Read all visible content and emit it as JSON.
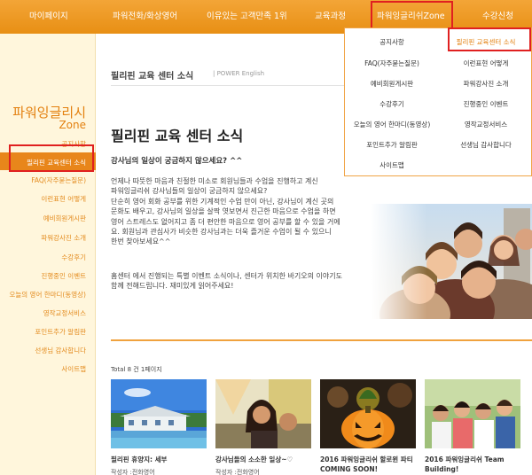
{
  "nav": {
    "items": [
      "마이페이지",
      "파워전화/화상영어",
      "이유있는 고객만족 1위",
      "교육과정",
      "파워잉글리쉬Zone",
      "수강신청"
    ]
  },
  "dropdown": {
    "col1": [
      "공지사항",
      "FAQ(자주묻는질문)",
      "예비회원게시판",
      "수강후기",
      "오늘의 영어 한마디(동영상)",
      "포인트추가 알림판",
      "사이트맵"
    ],
    "col2": [
      "필리핀 교육센터 소식",
      "이런표현 어떻게",
      "파워강사진 소개",
      "진행중인 이벤트",
      "영작교정서비스",
      "선생님 감사합니다"
    ]
  },
  "sidebar": {
    "title": "파워잉글리시",
    "subtitle": "Zone",
    "items": [
      "공지사항",
      "필리핀 교육센터 소식",
      "FAQ(자주묻는질문)",
      "이런표현 어떻게",
      "예비회원게시판",
      "파워강사진 소개",
      "수강후기",
      "진행중인 이벤트",
      "오늘의 영어 한마디(동영상)",
      "영작교정서비스",
      "포인트추가 알림판",
      "선생님 감사합니다",
      "사이트맵"
    ]
  },
  "main": {
    "breadcrumb_title": "필리핀 교육 센터 소식",
    "breadcrumb_sub": "| POWER English",
    "title": "필리핀 교육 센터 소식",
    "subtitle": "강사님의 일상이 궁금하지 않으세요? ^^",
    "para1_lines": [
      "언제나 따뜻한 마음과 친절한 미소로 회원님들과 수업을 진행하고 계신",
      "파워잉글리쉬 강사님들의 일상이 궁금하지 않으세요?",
      "단순히 영어 회화 공부를 위한 기계적인 수업 만이 아닌, 강사님이 계신 곳의",
      "문화도 배우고, 강사님의 일상을 살짝 엿보면서 진근한 마음으로 수업을 하면",
      "영어 스트레스도 없어지고 좀 더 편안한 마음으로 영어 공부를 할 수 있을 거에",
      "요. 회원님과 관심사가 비슷한 강사님과는 더욱 즐거운 수업이 될 수 있으니",
      "한번 찾아보세요^^"
    ],
    "para2_lines": [
      "홈센터 에서 진행되는 특별 이벤트 소식이나, 센터가 위치한 바기오의 이야기도",
      "함께 전해드립니다. 재미있게 읽어주세요!"
    ],
    "total": "Total 8 건 1페이지"
  },
  "cards": [
    {
      "title": "필리핀 휴양지: 세부",
      "author": "작성자 :전화영어"
    },
    {
      "title": "강사님들의 소소한 일상~♡",
      "author": "작성자 :전화영어"
    },
    {
      "title": "2016 파워잉글리쉬 할로윈 파티 COMING SOON!",
      "author": ""
    },
    {
      "title": "2016 파워잉글리쉬 Team Building!",
      "author": ""
    }
  ],
  "colors": {
    "nav": "#e88f14",
    "accent": "#e3800f",
    "highlight_box": "#e02020",
    "sidebar_bg": "#fff6dc"
  }
}
